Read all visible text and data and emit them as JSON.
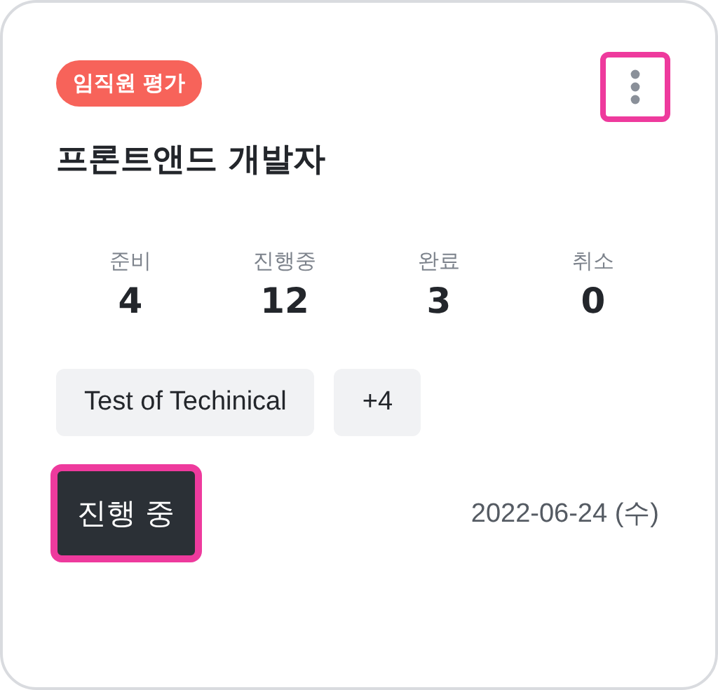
{
  "badge": "임직원 평가",
  "title": "프론트앤드 개발자",
  "stats": [
    {
      "label": "준비",
      "value": "4"
    },
    {
      "label": "진행중",
      "value": "12"
    },
    {
      "label": "완료",
      "value": "3"
    },
    {
      "label": "취소",
      "value": "0"
    }
  ],
  "tags": [
    "Test of Techinical",
    "+4"
  ],
  "status_button": {
    "label": "진행 중",
    "focused": true
  },
  "menu_button": {
    "focused": true
  },
  "date": "2022-06-24 (수)"
}
